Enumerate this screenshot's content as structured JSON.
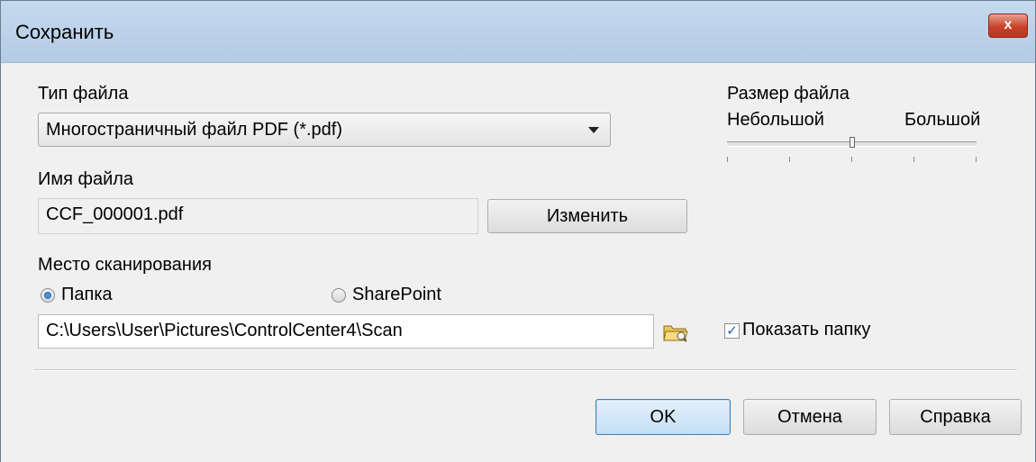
{
  "window": {
    "title": "Сохранить",
    "close_label": "x"
  },
  "file_type": {
    "label": "Тип файла",
    "selected": "Многостраничный файл PDF (*.pdf)"
  },
  "file_size": {
    "label": "Размер файла",
    "min_label": "Небольшой",
    "max_label": "Большой",
    "level_fraction": 0.5
  },
  "file_name": {
    "label": "Имя файла",
    "value": "CCF_000001.pdf",
    "change_button": "Изменить"
  },
  "scan_location": {
    "label": "Место сканирования",
    "options": [
      {
        "label": "Папка",
        "selected": true
      },
      {
        "label": "SharePoint",
        "selected": false
      }
    ],
    "path": "C:\\Users\\User\\Pictures\\ControlCenter4\\Scan",
    "show_folder_label": "Показать папку",
    "show_folder_checked": true
  },
  "buttons": {
    "ok": "OK",
    "cancel": "Отмена",
    "help": "Справка"
  }
}
